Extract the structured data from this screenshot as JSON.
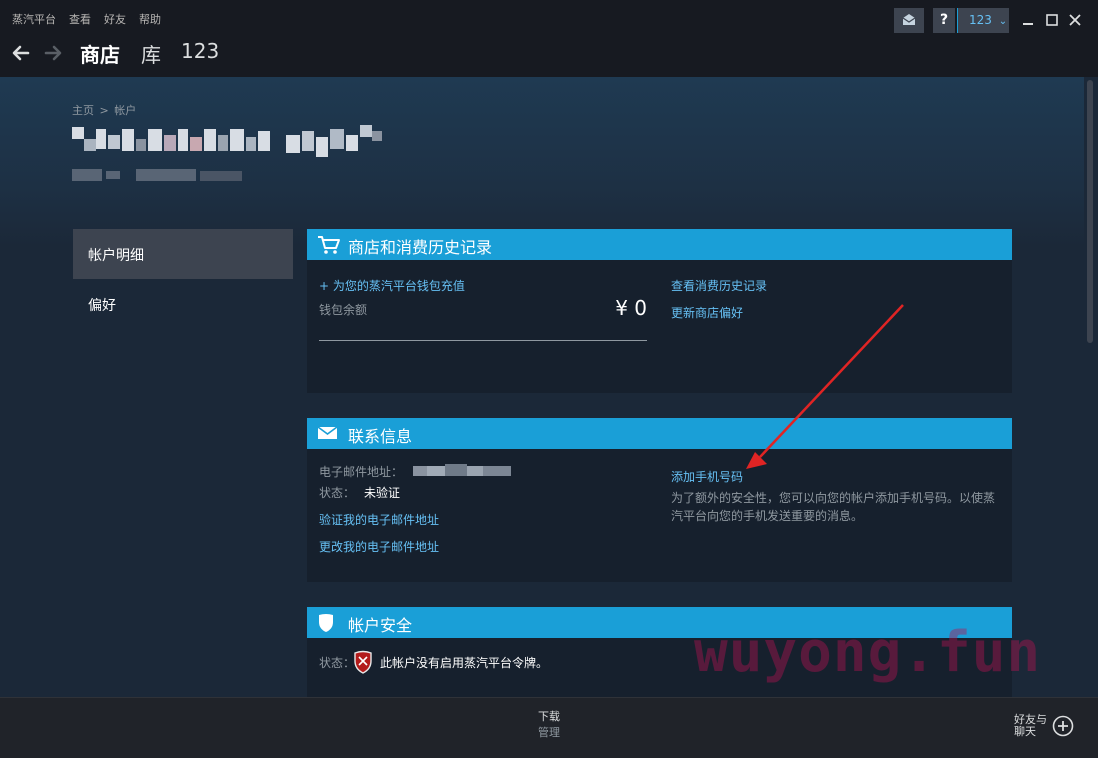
{
  "menu": [
    "蒸汽平台",
    "查看",
    "好友",
    "帮助"
  ],
  "nav": {
    "tabs": [
      "商店",
      "库",
      "123"
    ]
  },
  "window": {
    "help_label": "?",
    "account_name": "123",
    "account_chevron": "⌄"
  },
  "breadcrumb": {
    "home": "主页",
    "separator": ">",
    "current": "帐户"
  },
  "sidebar": {
    "items": [
      {
        "label": "帐户明细"
      },
      {
        "label": "偏好"
      }
    ]
  },
  "store_panel": {
    "title": "商店和消费历史记录",
    "add_funds": "+ 为您的蒸汽平台钱包充值",
    "wallet_label": "钱包余额",
    "wallet_amount": "¥ 0",
    "history_link": "查看消费历史记录",
    "prefs_link": "更新商店偏好"
  },
  "contact_panel": {
    "title": "联系信息",
    "email_label": "电子邮件地址：",
    "status_label": "状态：",
    "status_value": "未验证",
    "verify_link": "验证我的电子邮件地址",
    "change_link": "更改我的电子邮件地址",
    "add_phone_link": "添加手机号码",
    "phone_desc_1": "为了额外的安全性，您可以向您的帐户添加手机号码。以使蒸",
    "phone_desc_2": "汽平台向您的手机发送重要的消息。"
  },
  "security_panel": {
    "title": "帐户安全",
    "status_label": "状态：",
    "status_text": "此帐户没有启用蒸汽平台令牌。"
  },
  "bottom": {
    "download": "下载",
    "manage": "管理",
    "friends_1": "好友与",
    "friends_2": "聊天"
  },
  "watermark": "wuyong.fun",
  "colors": {
    "accent": "#1a9fd7",
    "link": "#66c0f4",
    "background": "#1b2838",
    "annotation_arrow": "#e02424"
  },
  "icons": [
    "back-arrow-icon",
    "forward-arrow-icon",
    "envelope-icon",
    "minimize-icon",
    "maximize-icon",
    "close-icon",
    "cart-icon",
    "mail-icon",
    "shield-icon",
    "shield-warning-icon",
    "plus-circle-icon"
  ]
}
